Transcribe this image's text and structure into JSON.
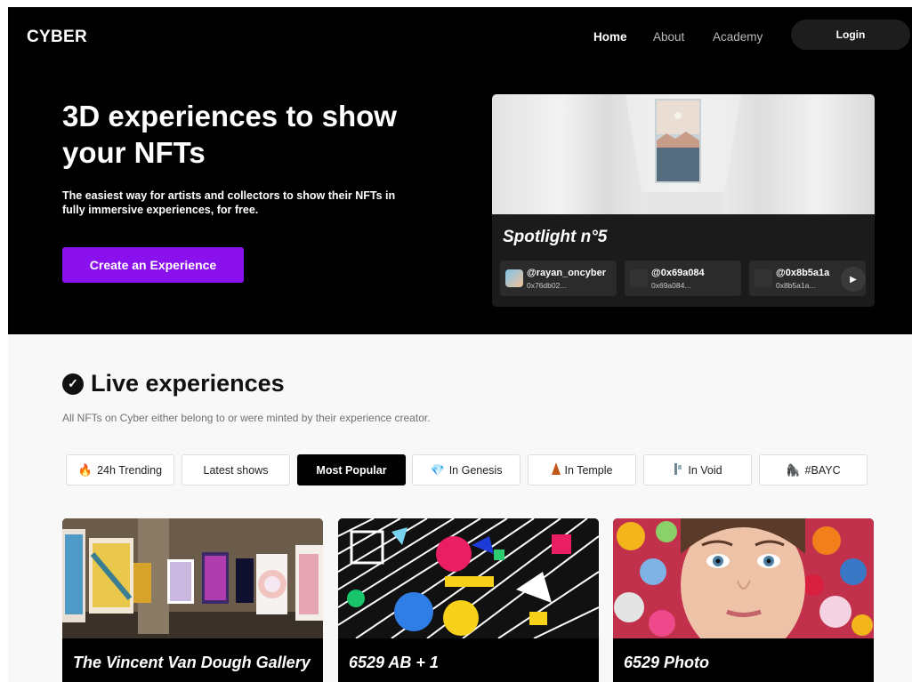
{
  "brand": {
    "logo": "CYBER"
  },
  "nav": {
    "items": [
      "Home",
      "About",
      "Academy"
    ],
    "login": "Login"
  },
  "hero": {
    "title": "3D experiences to show your NFTs",
    "subtitle": "The easiest way for artists and collectors to show their NFTs in fully immersive experiences, for free.",
    "cta": "Create an Experience"
  },
  "spotlight": {
    "title": "Spotlight n°5",
    "users": [
      {
        "name": "@rayan_oncyber",
        "address": "0x76db02..."
      },
      {
        "name": "@0x69a084",
        "address": "0x69a084..."
      },
      {
        "name": "@0x8b5a1a",
        "address": "0x8b5a1a..."
      }
    ],
    "next_icon": "chevron-right-icon"
  },
  "live": {
    "title": "Live experiences",
    "subtitle": "All NFTs on Cyber either belong to or were minted by their experience creator.",
    "tabs": [
      {
        "label": "24h Trending",
        "icon": "fire-icon"
      },
      {
        "label": "Latest shows",
        "icon": ""
      },
      {
        "label": "Most Popular",
        "icon": "",
        "active": true
      },
      {
        "label": "In Genesis",
        "icon": "diamond-icon"
      },
      {
        "label": "In Temple",
        "icon": "temple-icon"
      },
      {
        "label": "In Void",
        "icon": "void-icon"
      },
      {
        "label": "#BAYC",
        "icon": "ape-icon"
      }
    ],
    "cards": [
      {
        "title": "The Vincent Van Dough Gallery"
      },
      {
        "title": "6529 AB + 1"
      },
      {
        "title": "6529 Photo"
      }
    ]
  },
  "colors": {
    "accent": "#8a10ee",
    "hero_bg": "#000000",
    "section_bg": "#f8f8f8"
  }
}
